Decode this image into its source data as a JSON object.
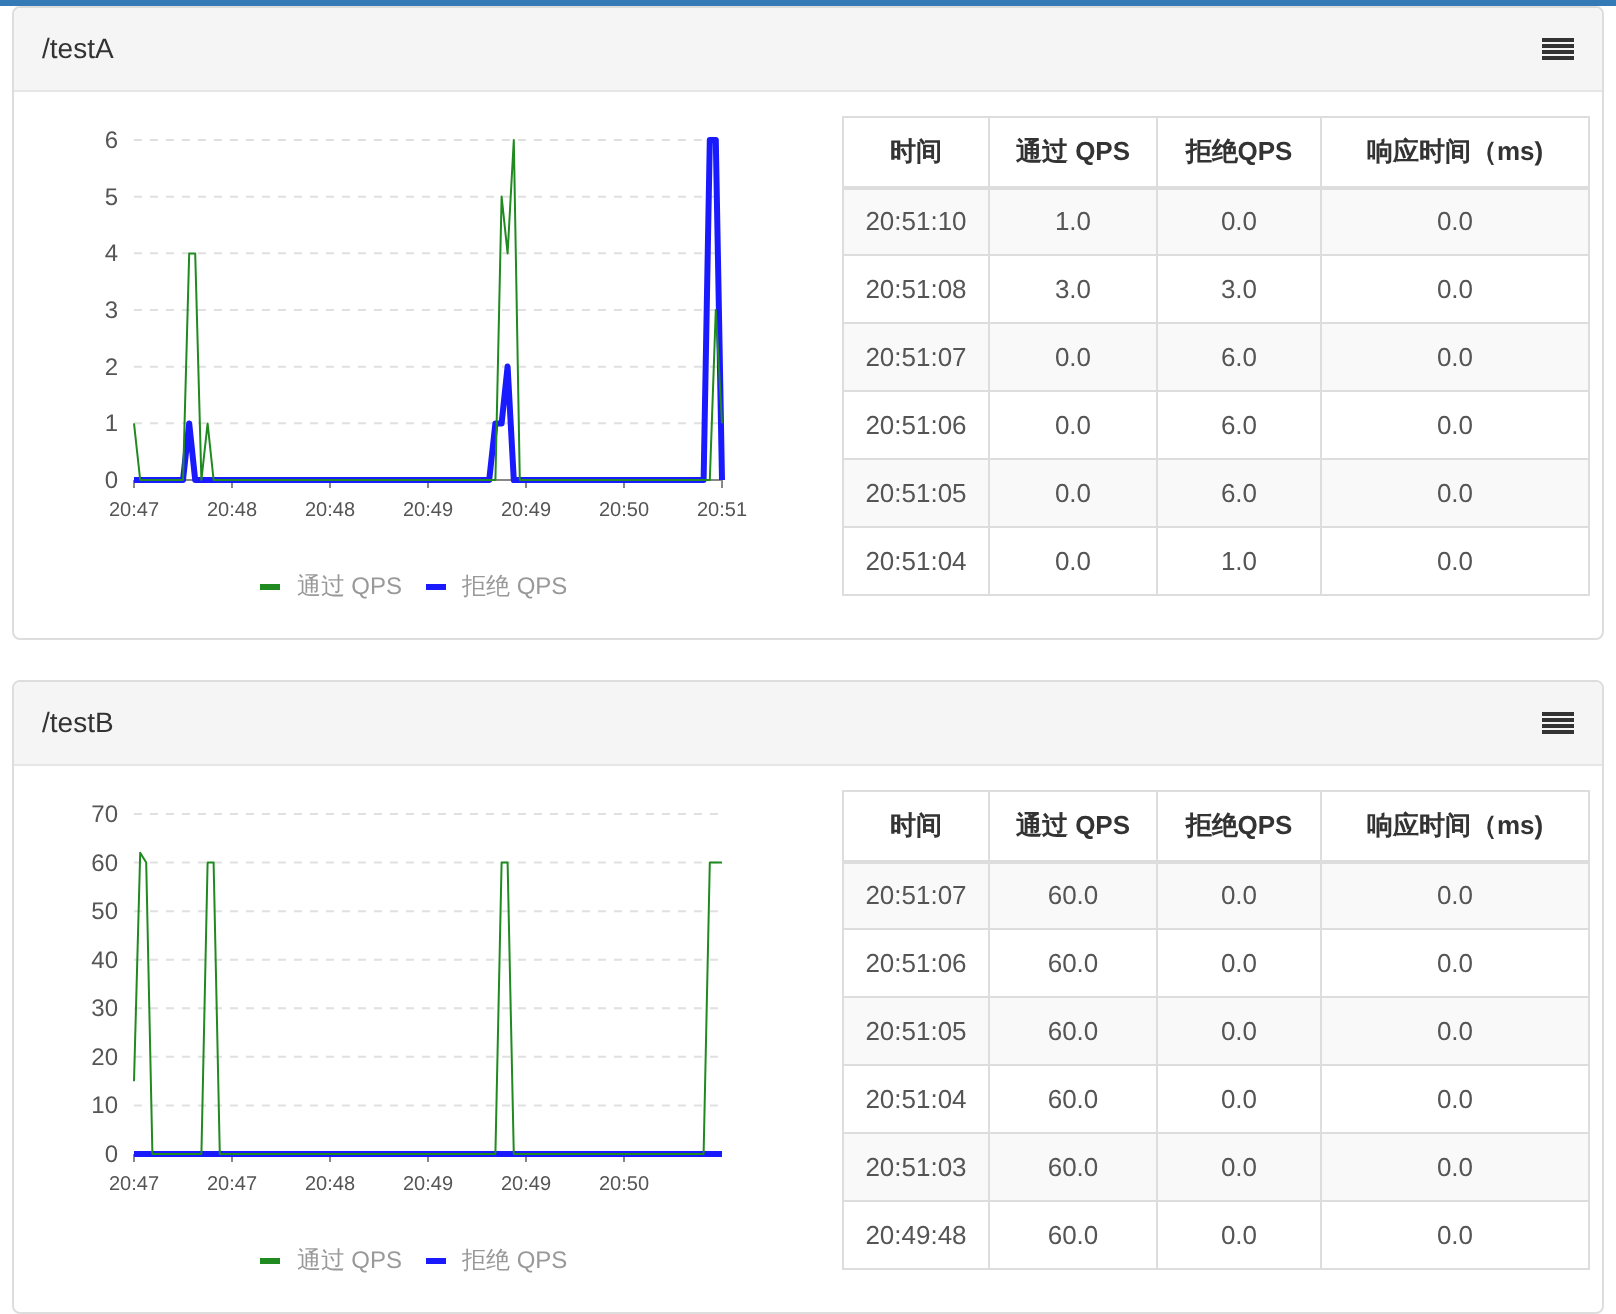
{
  "panels": [
    {
      "title": "/testA",
      "chart_data": {
        "type": "line",
        "grid": true,
        "legend": "bottom",
        "ylim": [
          0,
          6
        ],
        "yticks": [
          0,
          1,
          2,
          3,
          4,
          5,
          6
        ],
        "categories": [
          "20:47",
          null,
          null,
          null,
          null,
          null,
          null,
          null,
          null,
          null,
          null,
          null,
          null,
          null,
          null,
          null,
          "20:48",
          null,
          null,
          null,
          null,
          null,
          null,
          null,
          null,
          null,
          null,
          null,
          null,
          null,
          null,
          null,
          "20:48",
          null,
          null,
          null,
          null,
          null,
          null,
          null,
          null,
          null,
          null,
          null,
          null,
          null,
          null,
          null,
          "20:49",
          null,
          null,
          null,
          null,
          null,
          null,
          null,
          null,
          null,
          null,
          null,
          null,
          null,
          null,
          null,
          "20:49",
          null,
          null,
          null,
          null,
          null,
          null,
          null,
          null,
          null,
          null,
          null,
          null,
          null,
          null,
          null,
          "20:50",
          null,
          null,
          null,
          null,
          null,
          null,
          null,
          null,
          null,
          null,
          null,
          null,
          null,
          null,
          null,
          "20:51"
        ],
        "series": [
          {
            "name": "通过 QPS",
            "color": "#1f8a1f",
            "values": [
              1,
              0,
              0,
              0,
              0,
              0,
              0,
              0,
              0,
              4,
              4,
              0,
              1,
              0,
              0,
              0,
              0,
              0,
              0,
              0,
              0,
              0,
              0,
              0,
              0,
              0,
              0,
              0,
              0,
              0,
              0,
              0,
              0,
              0,
              0,
              0,
              0,
              0,
              0,
              0,
              0,
              0,
              0,
              0,
              0,
              0,
              0,
              0,
              0,
              0,
              0,
              0,
              0,
              0,
              0,
              0,
              0,
              0,
              0,
              0,
              5,
              4,
              6,
              0,
              0,
              0,
              0,
              0,
              0,
              0,
              0,
              0,
              0,
              0,
              0,
              0,
              0,
              0,
              0,
              0,
              0,
              0,
              0,
              0,
              0,
              0,
              0,
              0,
              0,
              0,
              0,
              0,
              0,
              0,
              0,
              3,
              1
            ]
          },
          {
            "name": "拒绝 QPS",
            "color": "#1a1aff",
            "values": [
              0,
              0,
              0,
              0,
              0,
              0,
              0,
              0,
              0,
              1,
              0,
              0,
              0,
              0,
              0,
              0,
              0,
              0,
              0,
              0,
              0,
              0,
              0,
              0,
              0,
              0,
              0,
              0,
              0,
              0,
              0,
              0,
              0,
              0,
              0,
              0,
              0,
              0,
              0,
              0,
              0,
              0,
              0,
              0,
              0,
              0,
              0,
              0,
              0,
              0,
              0,
              0,
              0,
              0,
              0,
              0,
              0,
              0,
              0,
              1,
              1,
              2,
              0,
              0,
              0,
              0,
              0,
              0,
              0,
              0,
              0,
              0,
              0,
              0,
              0,
              0,
              0,
              0,
              0,
              0,
              0,
              0,
              0,
              0,
              0,
              0,
              0,
              0,
              0,
              0,
              0,
              0,
              0,
              0,
              6,
              6,
              0
            ]
          }
        ]
      },
      "table": {
        "columns": [
          "时间",
          "通过 QPS",
          "拒绝QPS",
          "响应时间（ms)"
        ],
        "rows": [
          [
            "20:51:10",
            "1.0",
            "0.0",
            "0.0"
          ],
          [
            "20:51:08",
            "3.0",
            "3.0",
            "0.0"
          ],
          [
            "20:51:07",
            "0.0",
            "6.0",
            "0.0"
          ],
          [
            "20:51:06",
            "0.0",
            "6.0",
            "0.0"
          ],
          [
            "20:51:05",
            "0.0",
            "6.0",
            "0.0"
          ],
          [
            "20:51:04",
            "0.0",
            "1.0",
            "0.0"
          ]
        ]
      }
    },
    {
      "title": "/testB",
      "chart_data": {
        "type": "line",
        "grid": true,
        "legend": "bottom",
        "ylim": [
          0,
          70
        ],
        "yticks": [
          0,
          10,
          20,
          30,
          40,
          50,
          60,
          70
        ],
        "categories": [
          "20:47",
          null,
          null,
          null,
          null,
          null,
          null,
          null,
          null,
          null,
          null,
          null,
          null,
          null,
          null,
          null,
          "20:47",
          null,
          null,
          null,
          null,
          null,
          null,
          null,
          null,
          null,
          null,
          null,
          null,
          null,
          null,
          null,
          "20:48",
          null,
          null,
          null,
          null,
          null,
          null,
          null,
          null,
          null,
          null,
          null,
          null,
          null,
          null,
          null,
          "20:49",
          null,
          null,
          null,
          null,
          null,
          null,
          null,
          null,
          null,
          null,
          null,
          null,
          null,
          null,
          null,
          "20:49",
          null,
          null,
          null,
          null,
          null,
          null,
          null,
          null,
          null,
          null,
          null,
          null,
          null,
          null,
          null,
          "20:50",
          null,
          null,
          null,
          null,
          null,
          null,
          null,
          null,
          null,
          null,
          null,
          null,
          null,
          null,
          null,
          null
        ],
        "series": [
          {
            "name": "通过 QPS",
            "color": "#1f8a1f",
            "values": [
              15,
              62,
              60,
              0,
              0,
              0,
              0,
              0,
              0,
              0,
              0,
              0,
              60,
              60,
              0,
              0,
              0,
              0,
              0,
              0,
              0,
              0,
              0,
              0,
              0,
              0,
              0,
              0,
              0,
              0,
              0,
              0,
              0,
              0,
              0,
              0,
              0,
              0,
              0,
              0,
              0,
              0,
              0,
              0,
              0,
              0,
              0,
              0,
              0,
              0,
              0,
              0,
              0,
              0,
              0,
              0,
              0,
              0,
              0,
              0,
              60,
              60,
              0,
              0,
              0,
              0,
              0,
              0,
              0,
              0,
              0,
              0,
              0,
              0,
              0,
              0,
              0,
              0,
              0,
              0,
              0,
              0,
              0,
              0,
              0,
              0,
              0,
              0,
              0,
              0,
              0,
              0,
              0,
              0,
              60,
              60,
              60
            ]
          },
          {
            "name": "拒绝 QPS",
            "color": "#1a1aff",
            "values": [
              0,
              0,
              0,
              0,
              0,
              0,
              0,
              0,
              0,
              0,
              0,
              0,
              0,
              0,
              0,
              0,
              0,
              0,
              0,
              0,
              0,
              0,
              0,
              0,
              0,
              0,
              0,
              0,
              0,
              0,
              0,
              0,
              0,
              0,
              0,
              0,
              0,
              0,
              0,
              0,
              0,
              0,
              0,
              0,
              0,
              0,
              0,
              0,
              0,
              0,
              0,
              0,
              0,
              0,
              0,
              0,
              0,
              0,
              0,
              0,
              0,
              0,
              0,
              0,
              0,
              0,
              0,
              0,
              0,
              0,
              0,
              0,
              0,
              0,
              0,
              0,
              0,
              0,
              0,
              0,
              0,
              0,
              0,
              0,
              0,
              0,
              0,
              0,
              0,
              0,
              0,
              0,
              0,
              0,
              0,
              0,
              0
            ]
          }
        ]
      },
      "table": {
        "columns": [
          "时间",
          "通过 QPS",
          "拒绝QPS",
          "响应时间（ms)"
        ],
        "rows": [
          [
            "20:51:07",
            "60.0",
            "0.0",
            "0.0"
          ],
          [
            "20:51:06",
            "60.0",
            "0.0",
            "0.0"
          ],
          [
            "20:51:05",
            "60.0",
            "0.0",
            "0.0"
          ],
          [
            "20:51:04",
            "60.0",
            "0.0",
            "0.0"
          ],
          [
            "20:51:03",
            "60.0",
            "0.0",
            "0.0"
          ],
          [
            "20:49:48",
            "60.0",
            "0.0",
            "0.0"
          ]
        ]
      }
    }
  ]
}
